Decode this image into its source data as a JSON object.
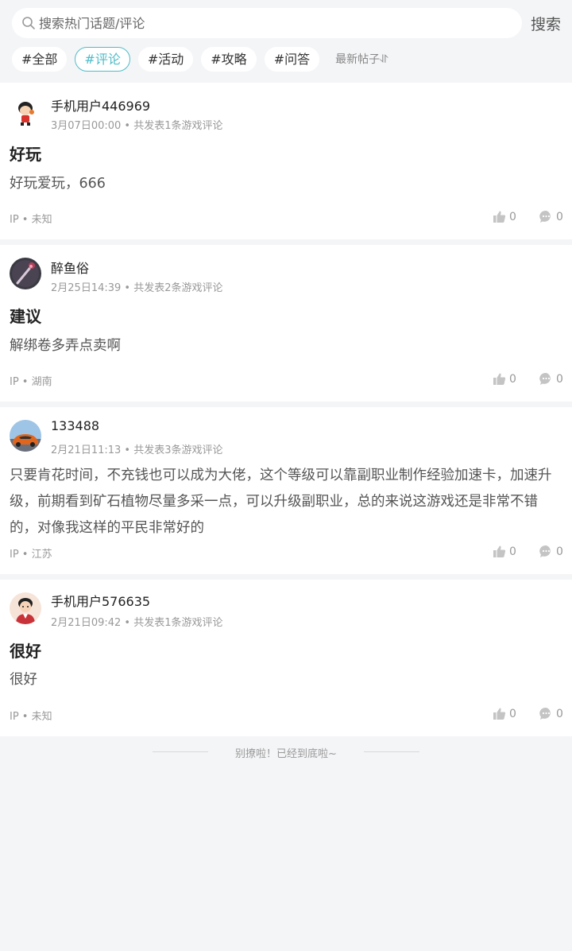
{
  "search": {
    "placeholder": "搜索热门话题/评论",
    "button_label": "搜索"
  },
  "tags": [
    {
      "label": "#全部",
      "active": false
    },
    {
      "label": "#评论",
      "active": true
    },
    {
      "label": "#活动",
      "active": false
    },
    {
      "label": "#攻略",
      "active": false
    },
    {
      "label": "#问答",
      "active": false
    }
  ],
  "sort_label": "最新帖子⥯",
  "posts": [
    {
      "username": "手机用户446969",
      "meta": "3月07日00:00 • 共发表1条游戏评论",
      "title": "好玩",
      "body": "好玩爱玩，666",
      "ip": "IP • 未知",
      "likes": "0",
      "comments": "0",
      "avatar_icon": "cartoon-boy-avatar"
    },
    {
      "username": "醉鱼俗",
      "meta": "2月25日14:39 • 共发表2条游戏评论",
      "title": "建议",
      "body": "解绑卷多弄点卖啊",
      "ip": "IP • 湖南",
      "likes": "0",
      "comments": "0",
      "avatar_icon": "staff-weapon-avatar"
    },
    {
      "username": "133488",
      "meta": "2月21日11:13 • 共发表3条游戏评论",
      "title": "",
      "body": "只要肯花时间，不充钱也可以成为大佬，这个等级可以靠副职业制作经验加速卡，加速升级，前期看到矿石植物尽量多采一点，可以升级副职业，总的来说这游戏还是非常不错的，对像我这样的平民非常好的",
      "ip": "IP • 江苏",
      "likes": "0",
      "comments": "0",
      "avatar_icon": "sports-car-avatar"
    },
    {
      "username": "手机用户576635",
      "meta": "2月21日09:42 • 共发表1条游戏评论",
      "title": "很好",
      "body": "很好",
      "ip": "IP • 未知",
      "likes": "0",
      "comments": "0",
      "avatar_icon": "cartoon-man-avatar"
    }
  ],
  "footer_text": "别撩啦！已经到底啦~",
  "colors": {
    "accent": "#4fbcc9",
    "background": "#f4f5f7"
  }
}
